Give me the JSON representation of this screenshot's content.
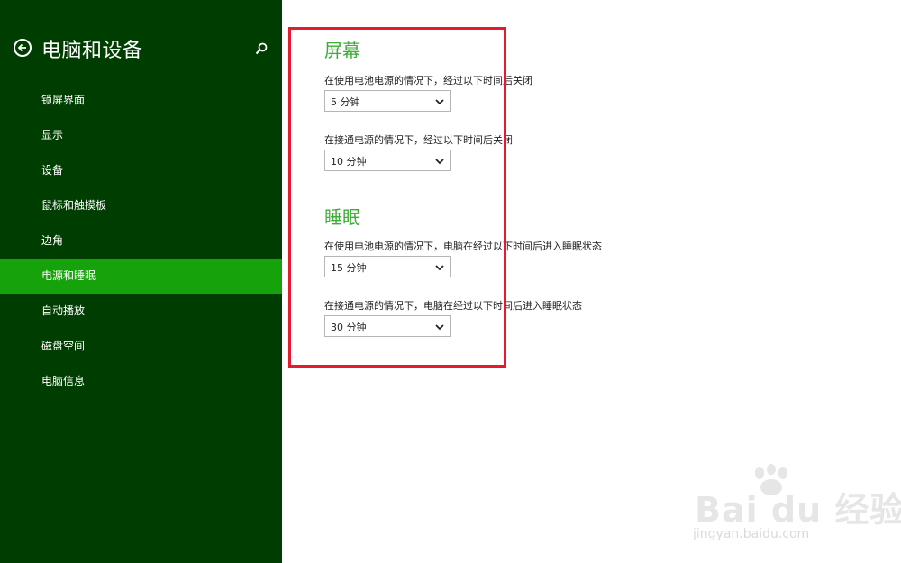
{
  "sidebar": {
    "title": "电脑和设备",
    "back_icon": "back-arrow-icon",
    "search_icon": "search-icon",
    "items": [
      {
        "label": "锁屏界面"
      },
      {
        "label": "显示"
      },
      {
        "label": "设备"
      },
      {
        "label": "鼠标和触摸板"
      },
      {
        "label": "边角"
      },
      {
        "label": "电源和睡眠",
        "active": true
      },
      {
        "label": "自动播放"
      },
      {
        "label": "磁盘空间"
      },
      {
        "label": "电脑信息"
      }
    ]
  },
  "screen": {
    "title": "屏幕",
    "battery_label": "在使用电池电源的情况下，经过以下时间后关闭",
    "battery_value": "5 分钟",
    "plugged_label": "在接通电源的情况下，经过以下时间后关闭",
    "plugged_value": "10 分钟"
  },
  "sleep": {
    "title": "睡眠",
    "battery_label": "在使用电池电源的情况下，电脑在经过以下时间后进入睡眠状态",
    "battery_value": "15 分钟",
    "plugged_label": "在接通电源的情况下，电脑在经过以下时间后进入睡眠状态",
    "plugged_value": "30 分钟"
  },
  "watermark": {
    "brand": "Bai du 经验",
    "url": "jingyan.baidu.com"
  },
  "colors": {
    "sidebar_bg": "#003d00",
    "active_item": "#16a20a",
    "section_title": "#3cae36",
    "highlight": "#e31b2b"
  }
}
